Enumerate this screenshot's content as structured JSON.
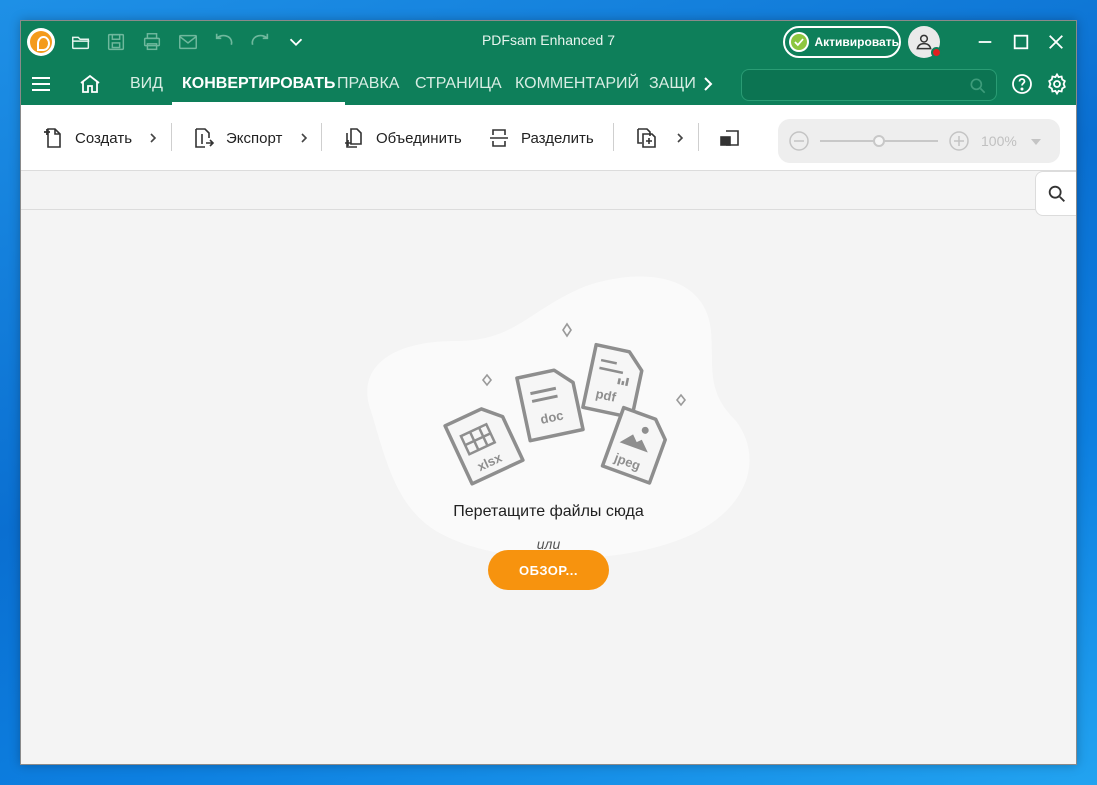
{
  "window": {
    "title": "PDFsam Enhanced 7"
  },
  "titlebar": {
    "quick_icons": [
      "open-folder-icon",
      "save-icon",
      "print-icon",
      "mail-icon",
      "undo-icon",
      "redo-icon",
      "chevron-down-icon"
    ],
    "activate_label": "Активировать"
  },
  "menu": {
    "items": [
      "ВИД",
      "КОНВЕРТИРОВАТЬ",
      "ПРАВКА",
      "СТРАНИЦА",
      "КОММЕНТАРИЙ",
      "ЗАЩИ"
    ],
    "active": "КОНВЕРТИРОВАТЬ",
    "search_placeholder": ""
  },
  "toolbar": {
    "create_label": "Создать",
    "export_label": "Экспорт",
    "merge_label": "Объединить",
    "split_label": "Разделить",
    "zoom_value": "100%",
    "zoom_level_fraction": 0.5
  },
  "dropzone": {
    "prompt": "Перетащите файлы сюда",
    "or_text": "или",
    "browse_label": "ОБЗОР...",
    "file_labels": {
      "xlsx": "xlsx",
      "doc": "doc",
      "pdf": "pdf",
      "jpeg": "jpeg"
    }
  },
  "colors": {
    "header_green": "#0e7f5a",
    "accent_orange": "#f7930e",
    "activate_check": "#8cc63f",
    "notification_red": "#e02020"
  }
}
